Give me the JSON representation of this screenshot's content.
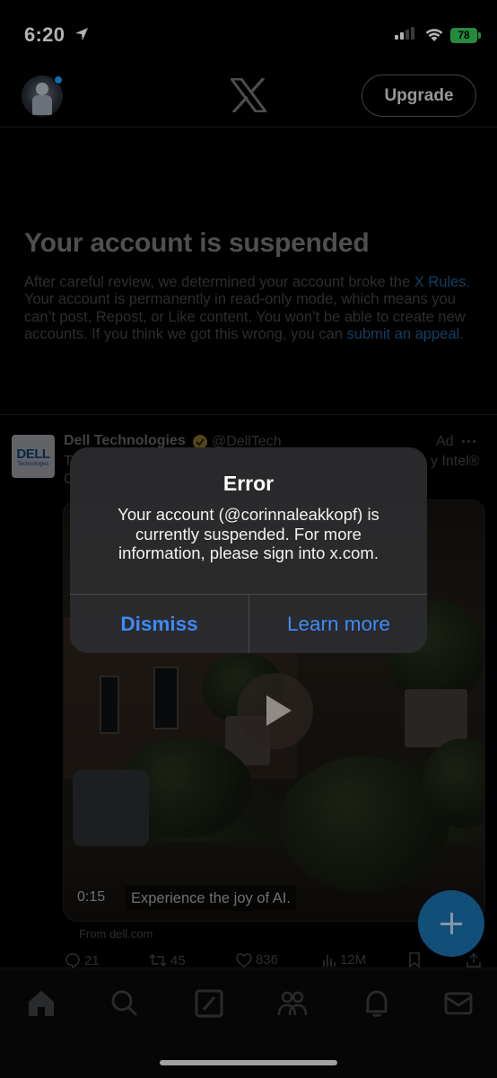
{
  "status_bar": {
    "time": "6:20",
    "battery": "78",
    "icons": [
      "location-arrow-icon",
      "cellular-signal-icon",
      "wifi-icon",
      "battery-charging-icon"
    ]
  },
  "header": {
    "logo": "X",
    "upgrade_label": "Upgrade",
    "avatar_notification": true
  },
  "notice": {
    "title": "Your account is suspended",
    "body_1": "After careful review, we determined your account broke the ",
    "link_rules": "X Rules",
    "body_2": ". Your account is permanently in read-only mode, which means you can’t post, Repost, or Like content. You won’t be able to create new accounts. If you think we got this wrong, you can ",
    "link_appeal": "submit an appeal",
    "body_3": "."
  },
  "tweet": {
    "logo_word": "DELL",
    "logo_sub": "Technologies",
    "author": "Dell Technologies",
    "handle": "@DellTech",
    "ad_label": "Ad",
    "text_start": "T",
    "text_end": "y Intel®",
    "text_line2": "C",
    "video_duration": "0:15",
    "video_caption": "Experience the joy of AI.",
    "source": "From dell.com",
    "actions": {
      "replies": "21",
      "reposts": "45",
      "likes": "836",
      "views": "12M"
    }
  },
  "alert": {
    "title": "Error",
    "message": "Your account (@corinnaleakkopf) is currently suspended. For more information, please sign into x.com.",
    "dismiss_label": "Dismiss",
    "learn_more_label": "Learn more"
  },
  "bottom_nav": {
    "items": [
      "home-icon",
      "search-icon",
      "grok-icon",
      "communities-icon",
      "notifications-icon",
      "messages-icon"
    ],
    "active": "home-icon"
  },
  "colors": {
    "background": "#000000",
    "link": "#1d9bf0",
    "alert_button": "#3d8af7",
    "fab": "#1d9bf0"
  }
}
